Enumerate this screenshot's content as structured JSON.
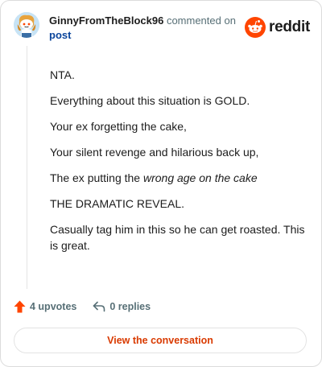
{
  "header": {
    "username": "GinnyFromTheBlock96",
    "action_text": "commented on",
    "post_link": "post",
    "logo_text": "reddit"
  },
  "comment": {
    "paragraphs": [
      "NTA.",
      "Everything about this situation is GOLD.",
      "Your ex forgetting the cake,",
      "Your silent revenge and hilarious back up,",
      "THE DRAMATIC REVEAL.",
      "Casually tag him in this so he can get roasted. This is great."
    ],
    "p5_prefix": "The ex putting the ",
    "p5_emphasis": "wrong age on the cake"
  },
  "footer": {
    "upvotes": "4 upvotes",
    "replies": "0 replies",
    "view_button": "View the conversation"
  },
  "colors": {
    "brand": "#ff4500",
    "link": "#0a449b",
    "muted": "#576f76",
    "cta": "#d93a00"
  },
  "icons": {
    "avatar": "snoo-avatar-icon",
    "logo": "reddit-logo-icon",
    "upvote": "upvote-arrow-icon",
    "reply": "reply-arrow-icon"
  }
}
